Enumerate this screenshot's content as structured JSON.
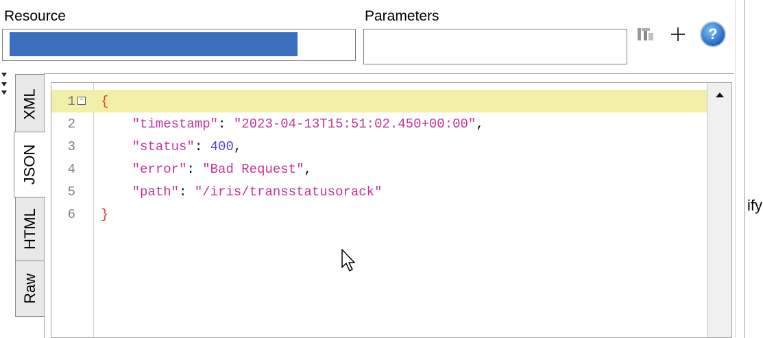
{
  "resource": {
    "label": "Resource"
  },
  "parameters": {
    "label": "Parameters"
  },
  "toolbar": {
    "icons": [
      "format-icon",
      "plus-icon",
      "help-icon"
    ]
  },
  "tabs": [
    {
      "label": "XML",
      "active": false
    },
    {
      "label": "JSON",
      "active": true
    },
    {
      "label": "HTML",
      "active": false
    },
    {
      "label": "Raw",
      "active": false
    }
  ],
  "editor": {
    "lines": [
      {
        "num": "1",
        "text": "{"
      },
      {
        "num": "2",
        "text": "    \"timestamp\": \"2023-04-13T15:51:02.450+00:00\","
      },
      {
        "num": "3",
        "text": "    \"status\": 400,"
      },
      {
        "num": "4",
        "text": "    \"error\": \"Bad Request\","
      },
      {
        "num": "5",
        "text": "    \"path\": \"/iris/transstatusorack\""
      },
      {
        "num": "6",
        "text": "}"
      }
    ],
    "fold_symbol": "−"
  },
  "side_fragment": "ify",
  "colors": {
    "selection": "#3a6fbe",
    "current_line": "#f1efa8",
    "brace": "#e0452a",
    "string": "#c0349a",
    "number": "#5b3bd0"
  }
}
